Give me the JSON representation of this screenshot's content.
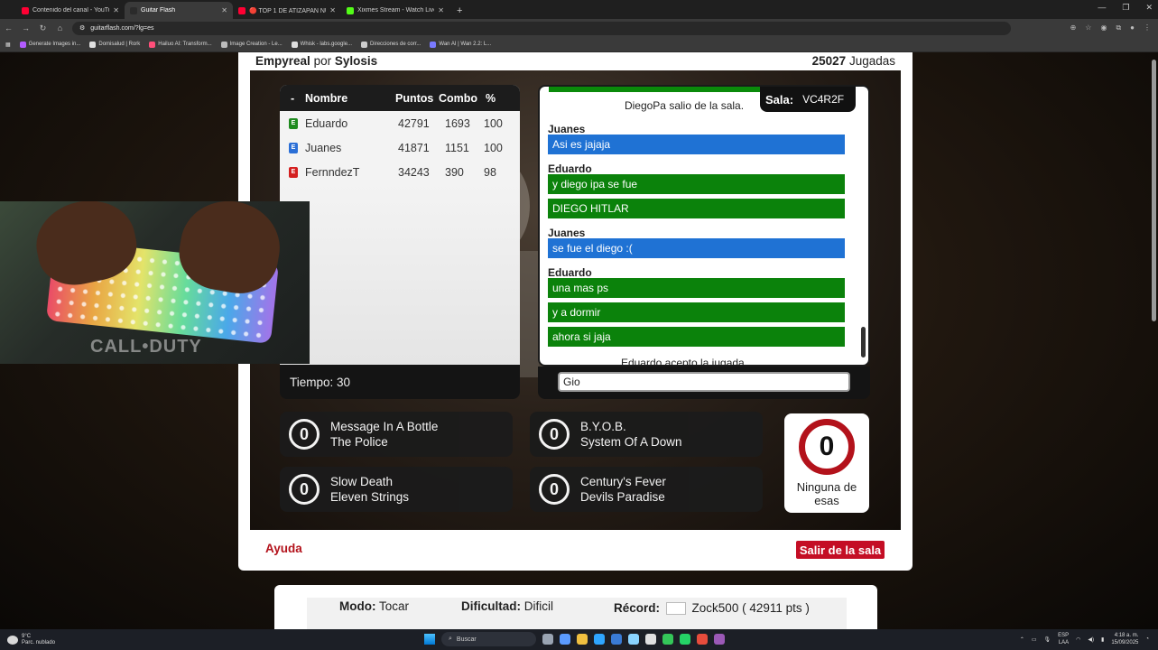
{
  "browser": {
    "tabs": [
      {
        "label": "Contenido del canal - YouTube",
        "color": "#ff0033",
        "active": false
      },
      {
        "label": "Guitar Flash",
        "color": "#2b2b2b",
        "active": true
      },
      {
        "label": "🔴 TOP 1 DE ATIZAPAN NU",
        "color": "#ff0033",
        "active": false
      },
      {
        "label": "Xixmes Stream - Watch Live o",
        "color": "#53fc18",
        "active": false
      }
    ],
    "new_tab": "+",
    "url": "guitarflash.com/?lg=es",
    "bookmarks": [
      {
        "label": "Generate Images in...",
        "color": "#b35cff"
      },
      {
        "label": "Domisalud | Rork",
        "color": "#e0e0e0"
      },
      {
        "label": "Hailuo AI: Transform...",
        "color": "#ff4f7a"
      },
      {
        "label": "Image Creation - Le...",
        "color": "#bbbbbb"
      },
      {
        "label": "Whisk - labs.google...",
        "color": "#dddddd"
      },
      {
        "label": "Direcciones de corr...",
        "color": "#cccccc"
      },
      {
        "label": "Wan AI | Wan 2.2: L...",
        "color": "#7a7aff"
      }
    ]
  },
  "header": {
    "song": "Empyreal",
    "by": "por",
    "artist": "Sylosis",
    "plays_count": "25027",
    "plays_label": "Jugadas"
  },
  "scoreboard": {
    "headers": {
      "pos": "-",
      "name": "Nombre",
      "points": "Puntos",
      "combo": "Combo",
      "pct": "%"
    },
    "rows": [
      {
        "badge": "E",
        "color": "#1f8a1f",
        "name": "Eduardo",
        "points": "42791",
        "combo": "1693",
        "pct": "100"
      },
      {
        "badge": "E",
        "color": "#2b6fd6",
        "name": "Juanes",
        "points": "41871",
        "combo": "1151",
        "pct": "100"
      },
      {
        "badge": "E",
        "color": "#d42020",
        "name": "FernndezT",
        "points": "34243",
        "combo": "390",
        "pct": "98"
      }
    ],
    "timer": "Tiempo: 30"
  },
  "webcam": {
    "overlay_text": "CALL•DUTY"
  },
  "chat": {
    "room_label": "Sala:",
    "room_code": "VC4R2F",
    "entries": [
      {
        "type": "system",
        "text": "DiegoPa salio de la sala."
      },
      {
        "type": "user",
        "text": "Juanes"
      },
      {
        "type": "msg",
        "color": "blue",
        "text": "Asi es jajaja"
      },
      {
        "type": "user",
        "text": "Eduardo"
      },
      {
        "type": "msg",
        "color": "green",
        "text": "y diego ipa se fue"
      },
      {
        "type": "msg",
        "color": "green",
        "text": "DIEGO HITLAR"
      },
      {
        "type": "user",
        "text": "Juanes"
      },
      {
        "type": "msg",
        "color": "blue",
        "text": "se fue el diego :("
      },
      {
        "type": "user",
        "text": "Eduardo"
      },
      {
        "type": "msg",
        "color": "green",
        "text": "una mas ps"
      },
      {
        "type": "msg",
        "color": "green",
        "text": "y a dormir"
      },
      {
        "type": "msg",
        "color": "green",
        "text": "ahora si jaja"
      },
      {
        "type": "system",
        "text": "Eduardo acepto la jugada."
      }
    ],
    "input_value": "Gio"
  },
  "options": [
    {
      "votes": "0",
      "song": "Message In A Bottle",
      "artist": "The Police"
    },
    {
      "votes": "0",
      "song": "B.Y.O.B.",
      "artist": "System Of A Down"
    },
    {
      "votes": "0",
      "song": "Slow Death",
      "artist": "Eleven Strings"
    },
    {
      "votes": "0",
      "song": "Century's Fever",
      "artist": "Devils Paradise"
    }
  ],
  "none_option": {
    "votes": "0",
    "label": "Ninguna de esas"
  },
  "footer": {
    "help": "Ayuda",
    "exit": "Salir de la sala"
  },
  "info": {
    "mode_label": "Modo:",
    "mode_value": "Tocar",
    "difficulty_label": "Dificultad:",
    "difficulty_value": "Dificil",
    "record_label": "Récord:",
    "record_value": "Zock500 ( 42911 pts )"
  },
  "taskbar": {
    "weather_temp": "9°C",
    "weather_desc": "Parc. nublado",
    "search": "Buscar",
    "lang": "ESP",
    "lang2": "LAA",
    "time": "4:18 a. m.",
    "date": "15/09/2025"
  }
}
